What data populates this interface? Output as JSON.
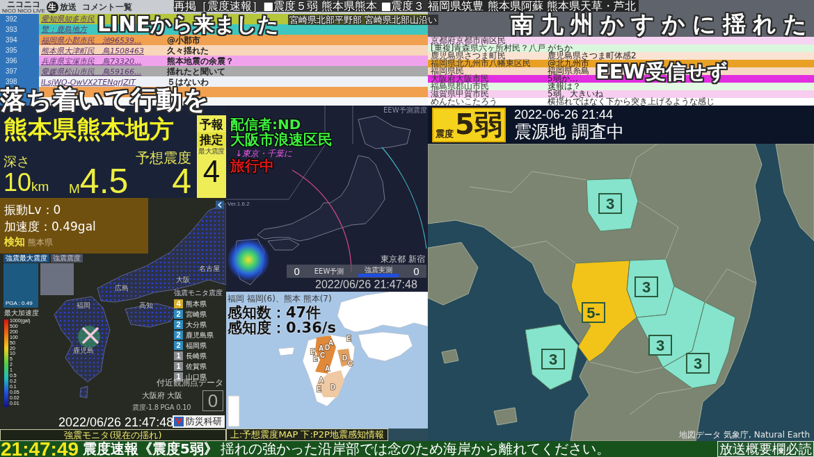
{
  "header": {
    "logo_brand": "ニコニコ",
    "logo_mark": "生",
    "logo_service": "放送",
    "logo_subtitle": "NICO NICO LIVE",
    "comment_list_title": "コメント一覧"
  },
  "comments_left": [
    {
      "number": "392",
      "user": "愛知県知多市民",
      "color": "#b6c63a"
    },
    {
      "number": "393",
      "user": "警：鹿島地方",
      "color": "#3fc6c0"
    },
    {
      "number": "394",
      "user": "福岡県小郡市民　池96539...",
      "text": "@小郡市",
      "color": "#f0a04e"
    },
    {
      "number": "395",
      "user": "熊本県大津町民　鳥1508463",
      "text": "久々揺れた",
      "color": "#f8d6ba"
    },
    {
      "number": "396",
      "user": "兵庫県宝塚市民　鳥73320...",
      "text": "熊本地震の余震？",
      "color": "#f1a2ed"
    },
    {
      "number": "397",
      "user": "愛媛県松山市民　鳥59166...",
      "text": "揺れたと聞いて",
      "color": "#a9a9a9"
    },
    {
      "number": "398",
      "user": "ILsjWQ-OwVX2TENqrJZIT",
      "text": "５はないわ",
      "color": "#eef2f7"
    },
    {
      "color": "#f0a04e"
    },
    {
      "color": "#f4f6f8"
    }
  ],
  "comments_right": [
    {
      "user": "京都府京都市南区民",
      "color": "#f7d3f3"
    },
    {
      "user": "[重複]青森県六ヶ所村民？八戸",
      "text": "がちか",
      "color": "#d9f7dd"
    },
    {
      "user": "鹿児島県さつま町民",
      "text": "鹿児島県さつま町体感2",
      "color": "#fbe3d3"
    },
    {
      "user": "福岡県北九州市八幡東区民",
      "text": "@北九州市",
      "color": "#e9a125"
    },
    {
      "user": "福岡県民",
      "text": "福岡県糸島",
      "color": "#f7d9c4"
    },
    {
      "user": "大阪府大阪市民",
      "text": "5弱か…",
      "color": "#e22ee0"
    },
    {
      "user": "福島県郡山市民",
      "text": "速報は？",
      "color": "#e3f8e3"
    },
    {
      "user": "滋賀県甲賀市民",
      "text": "5弱。大きいね",
      "color": "#f7cdf0"
    },
    {
      "user": "めんたいこたろう",
      "text": "横揺れではなく下から突き上げるような感じ",
      "color": "#ffffff"
    }
  ],
  "overlay_comments": [
    "LINEから来ました",
    "落ち着いて行動を",
    "南九州かすかに揺れた",
    "EEW受信せず"
  ],
  "ticker": {
    "lines": [
      "再掲［震度速報］■震度５弱 熊本県熊本 ■震度３ 福岡県筑豊 熊本県阿蘇 熊本県天草・芦北",
      "宮崎県北部平野部 宮崎県北部山沿い"
    ]
  },
  "eew": {
    "region": "熊本県熊本地方",
    "depth_label": "深さ",
    "depth_value": "10",
    "depth_unit": "km",
    "magnitude_prefix": "M",
    "magnitude": "4.5",
    "intensity_label": "予想震度",
    "intensity": "4",
    "badge": "予報",
    "estimate_label": "推定",
    "max_label": "最大震度",
    "max_intensity": "4"
  },
  "shake_monitor": {
    "readings": [
      "振動Lv：0",
      "加速度：0.49gal"
    ],
    "detect_label": "検知",
    "detect_place": "熊本県",
    "tabs": [
      {
        "label": "強震最大震度",
        "selected": true
      },
      {
        "label": "強震震度",
        "selected": false
      }
    ],
    "pga": "PGA : 0.49",
    "scale_title": "最大加速度",
    "scale_ticks": [
      "1000(gal)",
      "500",
      "200",
      "100",
      "50",
      "20",
      "10",
      "5",
      "2",
      "1",
      "0.5",
      "0.2",
      "0.1",
      "0.05",
      "0.02",
      "0.01"
    ],
    "map_labels": [
      "名古屋",
      "大阪",
      "広島",
      "福岡",
      "高知",
      "鹿児島"
    ],
    "legend_title": "強震モニタ震度",
    "prefectures": [
      {
        "intensity": "4",
        "name": "熊本県",
        "color": "#d4ae2c"
      },
      {
        "intensity": "2",
        "name": "宮崎県",
        "color": "#2f8cc0"
      },
      {
        "intensity": "2",
        "name": "大分県",
        "color": "#2f8cc0"
      },
      {
        "intensity": "2",
        "name": "鹿児島県",
        "color": "#2f8cc0"
      },
      {
        "intensity": "2",
        "name": "福岡県",
        "color": "#2f8cc0"
      },
      {
        "intensity": "1",
        "name": "長崎県",
        "color": "#8a8d92"
      },
      {
        "intensity": "1",
        "name": "佐賀県",
        "color": "#8a8d92"
      },
      {
        "intensity": "1",
        "name": "山口県",
        "color": "#8a8d92"
      }
    ],
    "nearby_title": "付近観測点データ",
    "nearby_station": "大阪府 大阪",
    "nearby_values": "震度-1.8 PGA 0.10",
    "nearby_intensity": "0",
    "timestamp": "2022/06/26 21:47:48",
    "provider": "防災科研",
    "caption": "強震モニタ(現在の揺れ)"
  },
  "eew_map": {
    "streamer": "配信者:ND",
    "location": "大阪市浪速区民",
    "note": "↓東京・千葉に",
    "status": "旅行中",
    "map_title": "EEW予測震度",
    "version": "Ver.1.6.2",
    "station": "東京都 新宿",
    "eew_value": "0",
    "eew_label": "EEW予測",
    "measured_label": "強震実測",
    "measured_value": "0",
    "timestamp": "2022/06/26 21:47:48"
  },
  "p2p": {
    "areas_text": "福岡 福岡(6)、熊本 熊本(7)",
    "count": "感知数：47件",
    "rate": "感知度：0.36/s",
    "grades": [
      "A",
      "E",
      "A",
      "D",
      "E",
      "C",
      "E",
      "D",
      "C",
      "A",
      "A",
      "D",
      "E"
    ],
    "caption": "上:予想震度MAP 下:P2P地震感知情報"
  },
  "quake": {
    "intensity_label": "震度",
    "intensity": "5弱",
    "time": "2022-06-26 21:44",
    "epicenter": "震源地 調査中",
    "areas": [
      {
        "label": "3",
        "color": "#86e3cc"
      },
      {
        "label": "3",
        "color": "#86e3cc"
      },
      {
        "label": "5-",
        "color": "#f2c318"
      },
      {
        "label": "3",
        "color": "#86e3cc"
      },
      {
        "label": "3",
        "color": "#86e3cc"
      },
      {
        "label": "3",
        "color": "#86e3cc"
      }
    ],
    "credit": "地図データ 気象庁, Natural Earth"
  },
  "bottom_bar": {
    "time": "21:47:49",
    "headline": "震度速報《震度5弱》",
    "message": "揺れの強かった沿岸部では念のため海岸から離れてください。",
    "notice": "放送概要欄必読"
  }
}
